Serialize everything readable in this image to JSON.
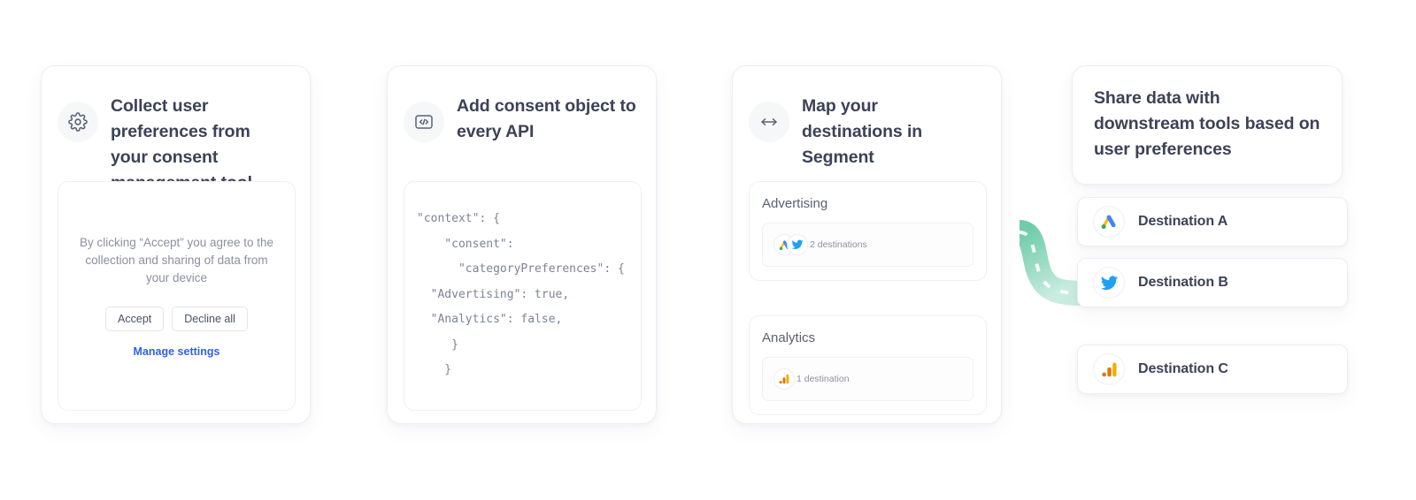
{
  "colors": {
    "pipe_green": "#4CBF96",
    "heading": "#3C4257",
    "muted": "#8B90A0",
    "link_blue": "#2F62DD",
    "card_border": "#ECEEF3",
    "google_ads_blue": "#4285F4",
    "google_ads_yellow": "#FBBC04",
    "google_ads_green": "#34A853",
    "twitter_blue": "#1DA1F2",
    "analytics_orange": "#F9AB00",
    "analytics_orange_dark": "#E37400"
  },
  "steps": [
    {
      "icon": "gear-icon",
      "title": "Collect user preferences from your consent management tool"
    },
    {
      "icon": "code-icon",
      "title": "Add consent object to every API"
    },
    {
      "icon": "horizontal-arrows-icon",
      "title": "Map your destinations in Segment"
    }
  ],
  "consent_banner": {
    "body": "By clicking “Accept” you agree to the collection and sharing of data from your device",
    "accept_label": "Accept",
    "decline_label": "Decline all",
    "manage_label": "Manage settings"
  },
  "code_block": {
    "text": "\"context\": {\n    \"consent\":\n      \"categoryPreferences\": {\n  \"Advertising\": true,\n  \"Analytics\": false,\n     }\n    }"
  },
  "categories": [
    {
      "name": "Advertising",
      "count_label": "2 destinations",
      "logos": [
        "google-ads-icon",
        "twitter-icon"
      ]
    },
    {
      "name": "Analytics",
      "count_label": "1 destination",
      "logos": [
        "google-analytics-icon"
      ]
    }
  ],
  "share": {
    "title": "Share data with downstream tools based on user preferences"
  },
  "destinations": [
    {
      "label": "Destination A",
      "icon": "google-ads-icon"
    },
    {
      "label": "Destination B",
      "icon": "twitter-icon"
    },
    {
      "label": "Destination C",
      "icon": "google-analytics-icon"
    }
  ]
}
